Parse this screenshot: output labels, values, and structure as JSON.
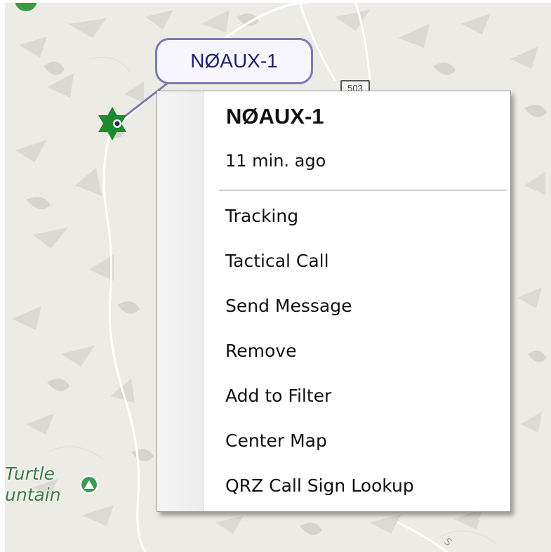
{
  "map": {
    "station_label": "NØAUX-1",
    "route_shield": "503",
    "place_name_line1": "Turtle",
    "place_name_line2": "untain",
    "colors": {
      "background": "#ecebe6",
      "label_border": "#7b79b4",
      "label_text": "#1d1f6a",
      "marker": "#1f8a2c",
      "place_text": "#3d7b45"
    },
    "icons": [
      "star-marker-icon",
      "mountain-peak-icon"
    ]
  },
  "context_menu": {
    "title": "NØAUX-1",
    "subtitle": "11 min. ago",
    "items": [
      {
        "label": "Tracking"
      },
      {
        "label": "Tactical Call"
      },
      {
        "label": "Send Message"
      },
      {
        "label": "Remove"
      },
      {
        "label": "Add to Filter"
      },
      {
        "label": "Center Map"
      },
      {
        "label": "QRZ Call Sign Lookup"
      }
    ]
  }
}
